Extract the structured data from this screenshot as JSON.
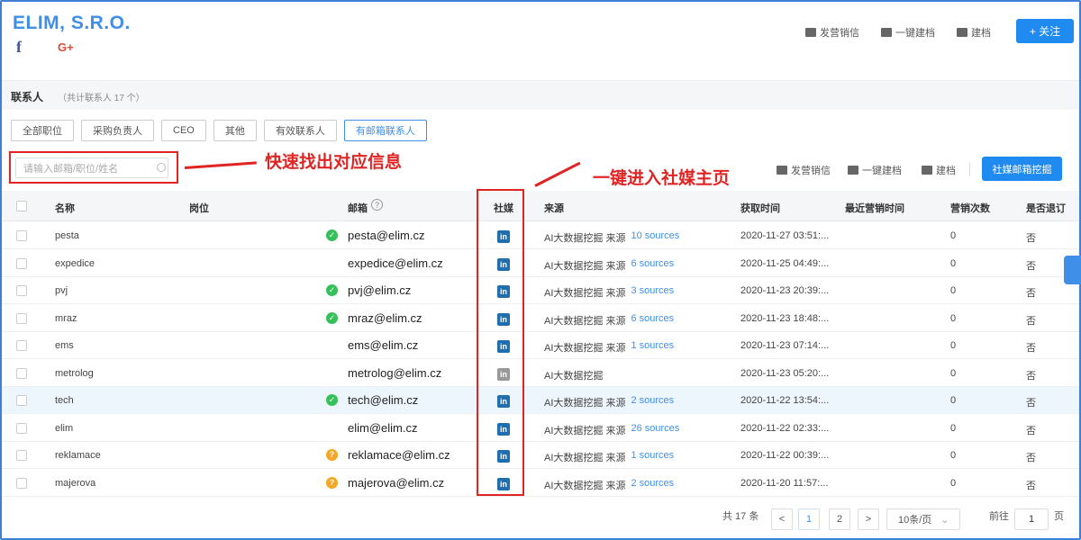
{
  "company": {
    "name": "ELIM, S.R.O.",
    "facebook": "f",
    "google": "G+"
  },
  "header_actions": {
    "send": "发营销信",
    "archive": "一键建档",
    "build": "建档",
    "follow": "+ 关注"
  },
  "contacts": {
    "title": "联系人",
    "count": "（共计联系人 17 个）"
  },
  "filters": [
    "全部职位",
    "采购负责人",
    "CEO",
    "其他",
    "有效联系人",
    "有邮箱联系人"
  ],
  "active_filter": "有邮箱联系人",
  "search": {
    "placeholder": "请输入邮箱/职位/姓名"
  },
  "annotations": {
    "search": "快速找出对应信息",
    "social": "一键进入社媒主页"
  },
  "table_actions": {
    "send": "发营销信",
    "archive": "一键建档",
    "build": "建档",
    "mine": "社媒邮箱挖掘"
  },
  "columns": {
    "name": "名称",
    "position": "岗位",
    "email": "邮箱",
    "social": "社媒",
    "source": "来源",
    "time": "获取时间",
    "last": "最近营销时间",
    "times": "营销次数",
    "unsub": "是否退订"
  },
  "rows": [
    {
      "name": "pesta",
      "status": "ok",
      "email": "pesta@elim.cz",
      "li": "active",
      "source": "AI大数据挖掘 来源",
      "sources": "10 sources",
      "time": "2020-11-27 03:51:...",
      "times": "0",
      "unsub": "否"
    },
    {
      "name": "expedice",
      "status": "",
      "email": "expedice@elim.cz",
      "li": "active",
      "source": "AI大数据挖掘 来源",
      "sources": "6 sources",
      "time": "2020-11-25 04:49:...",
      "times": "0",
      "unsub": "否"
    },
    {
      "name": "pvj",
      "status": "ok",
      "email": "pvj@elim.cz",
      "li": "active",
      "source": "AI大数据挖掘 来源",
      "sources": "3 sources",
      "time": "2020-11-23 20:39:...",
      "times": "0",
      "unsub": "否"
    },
    {
      "name": "mraz",
      "status": "ok",
      "email": "mraz@elim.cz",
      "li": "active",
      "source": "AI大数据挖掘 来源",
      "sources": "6 sources",
      "time": "2020-11-23 18:48:...",
      "times": "0",
      "unsub": "否"
    },
    {
      "name": "ems",
      "status": "",
      "email": "ems@elim.cz",
      "li": "active",
      "source": "AI大数据挖掘 来源",
      "sources": "1 sources",
      "time": "2020-11-23 07:14:...",
      "times": "0",
      "unsub": "否"
    },
    {
      "name": "metrolog",
      "status": "",
      "email": "metrolog@elim.cz",
      "li": "gray",
      "source": "AI大数据挖掘",
      "sources": "",
      "time": "2020-11-23 05:20:...",
      "times": "0",
      "unsub": "否"
    },
    {
      "name": "tech",
      "status": "ok",
      "email": "tech@elim.cz",
      "li": "active",
      "source": "AI大数据挖掘 来源",
      "sources": "2 sources",
      "time": "2020-11-22 13:54:...",
      "times": "0",
      "unsub": "否"
    },
    {
      "name": "elim",
      "status": "",
      "email": "elim@elim.cz",
      "li": "active",
      "source": "AI大数据挖掘 来源",
      "sources": "26 sources",
      "time": "2020-11-22 02:33:...",
      "times": "0",
      "unsub": "否"
    },
    {
      "name": "reklamace",
      "status": "warn",
      "email": "reklamace@elim.cz",
      "li": "active",
      "source": "AI大数据挖掘 来源",
      "sources": "1 sources",
      "time": "2020-11-22 00:39:...",
      "times": "0",
      "unsub": "否"
    },
    {
      "name": "majerova",
      "status": "warn",
      "email": "majerova@elim.cz",
      "li": "active",
      "source": "AI大数据挖掘 来源",
      "sources": "2 sources",
      "time": "2020-11-20 11:57:...",
      "times": "0",
      "unsub": "否"
    }
  ],
  "pagination": {
    "total": "共 17 条",
    "page1": "1",
    "page2": "2",
    "size": "10条/页",
    "goto": "前往",
    "goto_value": "1",
    "page_unit": "页"
  },
  "colors": {
    "accent": "#1f8af0",
    "annotation": "#e02424",
    "linkedin": "#1f6fb0"
  }
}
